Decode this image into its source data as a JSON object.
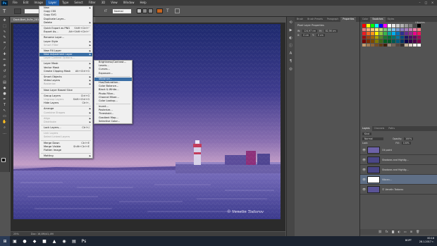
{
  "menubar": {
    "items": [
      "File",
      "Edit",
      "Image",
      "Layer",
      "Type",
      "Select",
      "Filter",
      "3D",
      "View",
      "Window",
      "Help"
    ],
    "active": "Layer"
  },
  "options": {
    "mode": "Normal"
  },
  "document": {
    "tab": "Dock-Bart_Sv3n_2012_1_A.jpg @ 25% (Vibrance 1, RGB/8)",
    "zoom": "25%",
    "doc_info": "Doc: 16,8M/41,4M"
  },
  "layer_menu": {
    "items": [
      {
        "label": "New",
        "arrow": true
      },
      {
        "label": "Copy CSS"
      },
      {
        "label": "Copy SVG"
      },
      {
        "label": "Duplicate Layer..."
      },
      {
        "label": "Delete",
        "arrow": true
      },
      {
        "sep": true
      },
      {
        "label": "Quick Export as PNG",
        "shortcut": "Shift+Ctrl+'"
      },
      {
        "label": "Export As...",
        "shortcut": "Alt+Shift+Ctrl+'"
      },
      {
        "sep": true
      },
      {
        "label": "Rename Layer..."
      },
      {
        "label": "Layer Style",
        "arrow": true
      },
      {
        "label": "Smart Filter",
        "arrow": true,
        "disabled": true
      },
      {
        "sep": true
      },
      {
        "label": "New Fill Layer",
        "arrow": true
      },
      {
        "label": "New Adjustment Layer",
        "arrow": true,
        "highlight": true
      },
      {
        "label": "Layer Content Options...",
        "disabled": true
      },
      {
        "sep": true
      },
      {
        "label": "Layer Mask",
        "arrow": true
      },
      {
        "label": "Vector Mask",
        "arrow": true
      },
      {
        "label": "Create Clipping Mask",
        "shortcut": "Alt+Ctrl+G"
      },
      {
        "sep": true
      },
      {
        "label": "Smart Objects",
        "arrow": true
      },
      {
        "label": "Video Layers",
        "arrow": true
      },
      {
        "label": "Rasterize",
        "arrow": true,
        "disabled": true
      },
      {
        "sep": true
      },
      {
        "label": "New Layer Based Slice"
      },
      {
        "sep": true
      },
      {
        "label": "Group Layers",
        "shortcut": "Ctrl+G"
      },
      {
        "label": "Ungroup Layers",
        "shortcut": "Shift+Ctrl+G",
        "disabled": true
      },
      {
        "label": "Hide Layers",
        "shortcut": "Ctrl+,"
      },
      {
        "sep": true
      },
      {
        "label": "Arrange",
        "arrow": true
      },
      {
        "label": "Combine Shapes",
        "arrow": true,
        "disabled": true
      },
      {
        "sep": true
      },
      {
        "label": "Align",
        "arrow": true,
        "disabled": true
      },
      {
        "label": "Distribute",
        "arrow": true,
        "disabled": true
      },
      {
        "sep": true
      },
      {
        "label": "Lock Layers...",
        "shortcut": "Ctrl+/"
      },
      {
        "sep": true
      },
      {
        "label": "Link Layers",
        "disabled": true
      },
      {
        "label": "Select Linked Layers",
        "disabled": true
      },
      {
        "sep": true
      },
      {
        "label": "Merge Down",
        "shortcut": "Ctrl+E"
      },
      {
        "label": "Merge Visible",
        "shortcut": "Shift+Ctrl+E"
      },
      {
        "label": "Flatten Image"
      },
      {
        "sep": true
      },
      {
        "label": "Matting",
        "arrow": true
      }
    ]
  },
  "adjust_menu": {
    "items": [
      {
        "label": "Brightness/Contrast..."
      },
      {
        "label": "Levels..."
      },
      {
        "label": "Curves..."
      },
      {
        "label": "Exposure..."
      },
      {
        "sep": true
      },
      {
        "label": "Vibrance...",
        "highlight": true
      },
      {
        "label": "Hue/Saturation..."
      },
      {
        "label": "Color Balance..."
      },
      {
        "label": "Black & White..."
      },
      {
        "label": "Photo Filter..."
      },
      {
        "label": "Channel Mixer..."
      },
      {
        "label": "Color Lookup..."
      },
      {
        "sep": true
      },
      {
        "label": "Invert..."
      },
      {
        "label": "Posterize..."
      },
      {
        "label": "Threshold..."
      },
      {
        "label": "Gradient Map..."
      },
      {
        "label": "Selective Color..."
      }
    ]
  },
  "properties": {
    "tabs": [
      "Brush",
      "Brush Presets",
      "Paragraph",
      "Properties"
    ],
    "active": "Properties",
    "title": "Pixel Layer Properties",
    "w": "W:",
    "h": "H:",
    "x": "X:",
    "y": "Y:",
    "w_val": "124,97 cm",
    "h_val": "82,56 cm",
    "x_val": "0 cm",
    "y_val": "0 cm"
  },
  "swatches": {
    "tabs": [
      "Color",
      "Swatches",
      "Styles"
    ],
    "active": "Swatches",
    "colors": [
      "#ff0000",
      "#ffff00",
      "#00ff00",
      "#00ffff",
      "#0000ff",
      "#ff00ff",
      "#ffffff",
      "#e6e6e6",
      "#cccccc",
      "#b3b3b3",
      "#999999",
      "#808080",
      "#4d4d4d",
      "#000000",
      "#f27c7c",
      "#f7a97c",
      "#fbcb7c",
      "#fff57c",
      "#c4df7b",
      "#7ccb7c",
      "#7bcbc6",
      "#7cc7f2",
      "#7c9cd7",
      "#8b7cc2",
      "#a57cc2",
      "#c87cb5",
      "#f07ca9",
      "#f07c7f",
      "#ee1c24",
      "#f26522",
      "#f7941d",
      "#fff200",
      "#8dc63f",
      "#39b54a",
      "#00a99d",
      "#00aeef",
      "#0072bc",
      "#2e3192",
      "#662d91",
      "#92278f",
      "#ec008c",
      "#ed145b",
      "#9e0b0f",
      "#a0410d",
      "#a36209",
      "#aba000",
      "#598527",
      "#197b30",
      "#007236",
      "#00746b",
      "#0076a3",
      "#004a80",
      "#1b1464",
      "#440e62",
      "#630460",
      "#9e005d",
      "#790000",
      "#7b2e00",
      "#7d4900",
      "#827b00",
      "#406618",
      "#005e20",
      "#005826",
      "#005952",
      "#005b7f",
      "#003663",
      "#0d004c",
      "#32004b",
      "#4b0049",
      "#7b0046",
      "#c69c6d",
      "#a67c52",
      "#8c6239",
      "#754c24",
      "#603913",
      "#42210b",
      "#998675",
      "#736357",
      "#534741",
      "#362f2d",
      "#c7b299",
      "#e0d6cc",
      "#f5f0eb",
      "#ffffff"
    ]
  },
  "libraries": {
    "label": "Libraries"
  },
  "layers": {
    "tabs": [
      "Layers",
      "Channels",
      "Paths"
    ],
    "active": "Layers",
    "kind": "Kind",
    "blend": "Normal",
    "opacity_label": "Opacity:",
    "opacity": "100%",
    "fill_label": "Fill:",
    "fill": "100%",
    "lock_label": "Lock:",
    "items": [
      {
        "name": "Oil paint",
        "thumb": "#6d62a8"
      },
      {
        "name": "Shadows and Highlig...",
        "thumb": "#4b4787"
      },
      {
        "name": "Shadows and Highlig...",
        "thumb": "#4b4787"
      },
      {
        "name": "Vibran...",
        "thumb": "#ffffff"
      },
      {
        "name": "© Venelin Todorov",
        "thumb": "#5a5396"
      }
    ]
  },
  "watermark": "© Venelin Todorov",
  "taskbar": {
    "icons": [
      "⊞",
      "▣",
      "●",
      "◆",
      "■",
      "▲",
      "◉",
      "▤",
      "Ps"
    ],
    "time": "00:16",
    "date": "28.1.2017 г.",
    "lang": "BGPT"
  },
  "colors": {
    "menuHighlight": "#3a6ea5",
    "psBlue": "#31a8ff"
  }
}
